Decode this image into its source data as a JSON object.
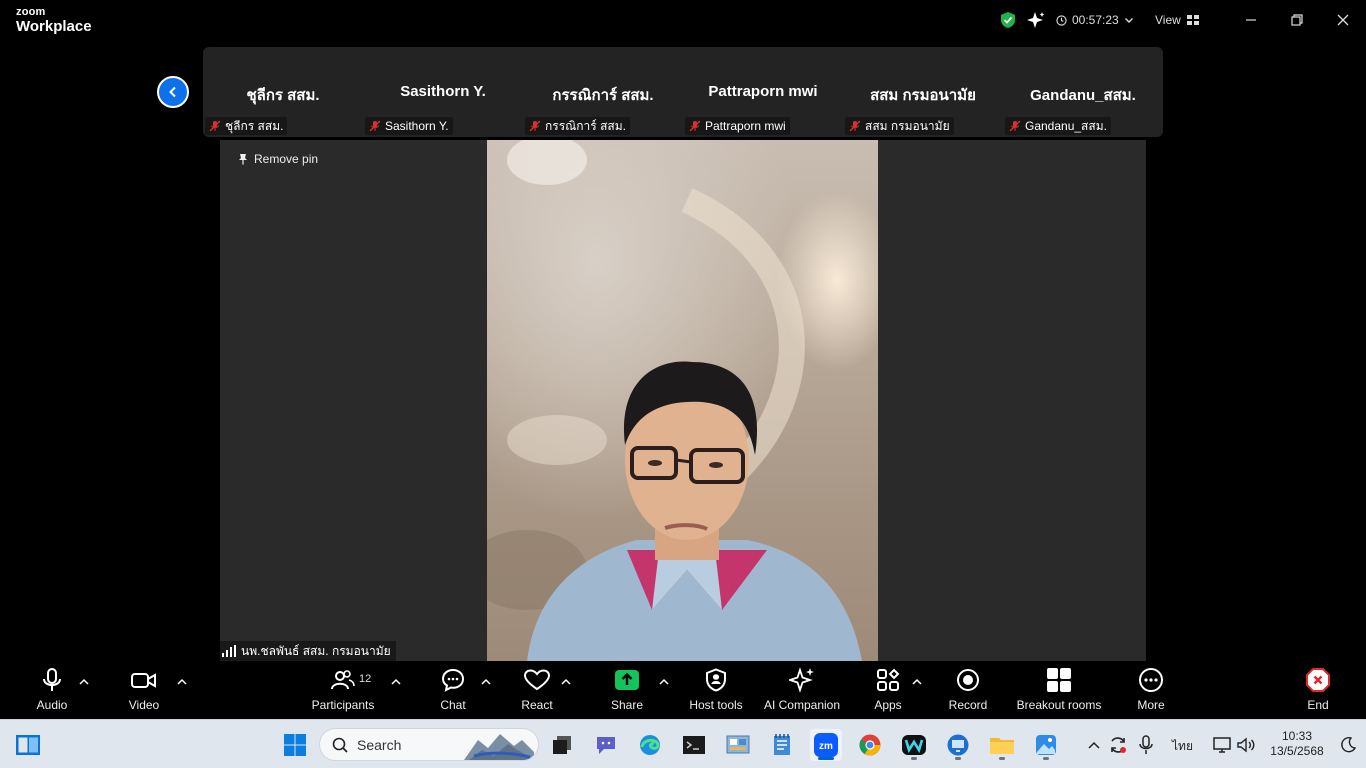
{
  "app": {
    "brand_top": "zoom",
    "brand_bottom": "Workplace"
  },
  "titlebar": {
    "timer": "00:57:23",
    "view_label": "View",
    "icons": [
      "shield-check-icon",
      "ai-sparkle-icon",
      "clock-icon",
      "chevron-down-icon",
      "grid-icon",
      "minimize-icon",
      "restore-icon",
      "close-icon"
    ]
  },
  "gallery": {
    "tiles": [
      {
        "display_name": "ชุลีกร สสม.",
        "label": "ชุลีกร สสม."
      },
      {
        "display_name": "Sasithorn Y.",
        "label": "Sasithorn Y."
      },
      {
        "display_name": "กรรณิการ์ สสม.",
        "label": "กรรณิการ์ สสม."
      },
      {
        "display_name": "Pattraporn mwi",
        "label": "Pattraporn mwi"
      },
      {
        "display_name": "สสม กรมอนามัย",
        "label": "สสม กรมอนามัย"
      },
      {
        "display_name": "Gandanu_สสม.",
        "label": "Gandanu_สสม."
      }
    ]
  },
  "stage": {
    "remove_pin_label": "Remove pin",
    "speaker_name": "นพ.ชลพันธ์ สสม. กรมอนามัย"
  },
  "toolbar": {
    "audio": "Audio",
    "video": "Video",
    "participants": "Participants",
    "participants_count": "12",
    "chat": "Chat",
    "react": "React",
    "share": "Share",
    "host_tools": "Host tools",
    "ai_companion": "AI Companion",
    "apps": "Apps",
    "record": "Record",
    "breakout_rooms": "Breakout rooms",
    "more": "More",
    "end": "End"
  },
  "taskbar": {
    "search_placeholder": "Search",
    "language": "ไทย",
    "time": "10:33",
    "date": "13/5/2568"
  },
  "colors": {
    "accent_blue": "#0e71eb",
    "share_green": "#13c35b",
    "end_red": "#e02828",
    "mute_red": "#e0312b"
  }
}
